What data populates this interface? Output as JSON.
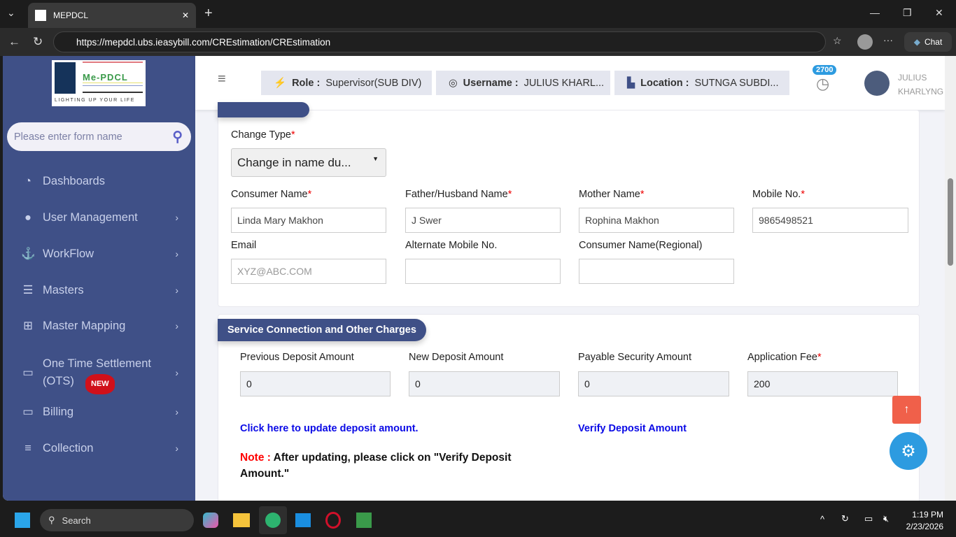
{
  "browser": {
    "tab_title": "MEPDCL",
    "url": "https://mepdcl.ubs.ieasybill.com/CREstimation/CREstimation",
    "chat_label": "Chat"
  },
  "sidebar": {
    "logo_text": "Me-PDCL",
    "logo_tagline": "LIGHTING UP YOUR LIFE",
    "search_placeholder": "Please enter form name",
    "items": [
      {
        "label": "Dashboards",
        "icon": "dashboard-icon"
      },
      {
        "label": "User Management",
        "icon": "user-icon"
      },
      {
        "label": "WorkFlow",
        "icon": "anchor-icon"
      },
      {
        "label": "Masters",
        "icon": "server-icon"
      },
      {
        "label": "Master Mapping",
        "icon": "sitemap-icon"
      },
      {
        "label": "One Time Settlement (OTS)",
        "icon": "monitor-icon",
        "badge": "NEW"
      },
      {
        "label": "Billing",
        "icon": "monitor-icon"
      },
      {
        "label": "Collection",
        "icon": "list-ol-icon"
      }
    ]
  },
  "header": {
    "role_label": "Role :",
    "role_value": "Supervisor(SUB DIV)",
    "username_label": "Username :",
    "username_value": "JULIUS KHARL...",
    "location_label": "Location :",
    "location_value": "SUTNGA SUBDI...",
    "notif_count": "2700",
    "user_line1": "JULIUS",
    "user_line2": "KHARLYNG"
  },
  "consumer": {
    "change_type_label": "Change Type",
    "change_type_value": "Change in name du...",
    "fields": [
      {
        "label": "Consumer Name",
        "required": true,
        "value": "Linda Mary Makhon"
      },
      {
        "label": "Father/Husband Name",
        "required": true,
        "value": "J Swer"
      },
      {
        "label": "Mother Name",
        "required": true,
        "value": "Rophina Makhon"
      },
      {
        "label": "Mobile No.",
        "required": true,
        "value": "9865498521"
      },
      {
        "label": "Email",
        "placeholder": "XYZ@ABC.COM",
        "value": ""
      },
      {
        "label": "Alternate Mobile No.",
        "value": ""
      },
      {
        "label": "Consumer Name(Regional)",
        "value": ""
      }
    ]
  },
  "charges": {
    "title": "Service Connection and Other Charges",
    "fields": [
      {
        "label": "Previous Deposit Amount",
        "value": "0"
      },
      {
        "label": "New Deposit Amount",
        "value": "0"
      },
      {
        "label": "Payable Security Amount",
        "value": "0"
      },
      {
        "label": "Application Fee",
        "value": "200"
      }
    ],
    "update_link": "Click here to update deposit amount.",
    "verify_link": "Verify Deposit Amount",
    "note_label": "Note :",
    "note_text": "After updating, please click on \"Verify Deposit Amount.\""
  },
  "taskbar": {
    "search": "Search",
    "time": "1:19 PM",
    "date": "2/23/2026"
  }
}
